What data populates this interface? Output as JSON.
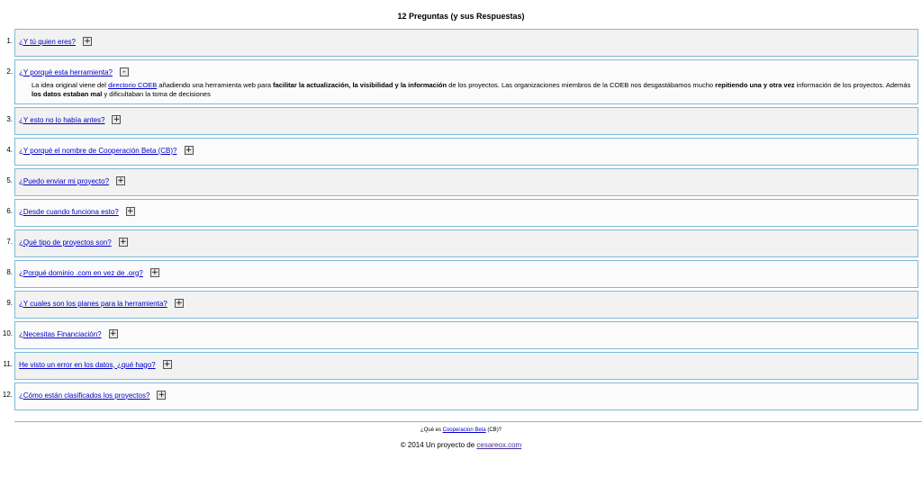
{
  "title": "12 Preguntas (y sus Respuestas)",
  "toggle_open": "+",
  "toggle_close": "-",
  "items": [
    {
      "num": "1.",
      "q": "¿Y tú quien eres?"
    },
    {
      "num": "2.",
      "q": "¿Y porqué esta herramienta?"
    },
    {
      "num": "3.",
      "q": "¿Y esto no lo había antes?"
    },
    {
      "num": "4.",
      "q": "¿Y porqué el nombre de Cooperación Beta (CB)?"
    },
    {
      "num": "5.",
      "q": "¿Puedo enviar mi proyecto?"
    },
    {
      "num": "6.",
      "q": "¿Desde cuando funciona esto?"
    },
    {
      "num": "7.",
      "q": "¿Qué tipo de proyectos son?"
    },
    {
      "num": "8.",
      "q": "¿Porqué dominio .com en vez de .org?"
    },
    {
      "num": "9.",
      "q": "¿Y cuales son los planes para la herramienta?"
    },
    {
      "num": "10.",
      "q": "¿Necesitas Financiación?"
    },
    {
      "num": "11.",
      "q": "He visto un error en los datos, ¿qué hago?"
    },
    {
      "num": "12.",
      "q": "¿Cómo están clasificados los proyectos?"
    }
  ],
  "answer2": {
    "t1": "La idea original viene del ",
    "link": "directorio COEB",
    "t2": " añadiendo una herramienta web para ",
    "b1": "facilitar la actualización, la visibilidad y la información",
    "t3": " de los proyectos. Las organizaciones miembros de la COEB nos desgastábamos mucho ",
    "b2": "repitiendo una y otra vez",
    "t4": " información de los proyectos. Además ",
    "b3": "los datos estaban mal",
    "t5": " y dificultaban la toma de decisiones"
  },
  "footer": {
    "pre": "¿Qué es ",
    "link": "Cooperacion Beta",
    "post": " (CB)?",
    "copy": "© 2014 Un proyecto de ",
    "author": "cesareox.com"
  }
}
